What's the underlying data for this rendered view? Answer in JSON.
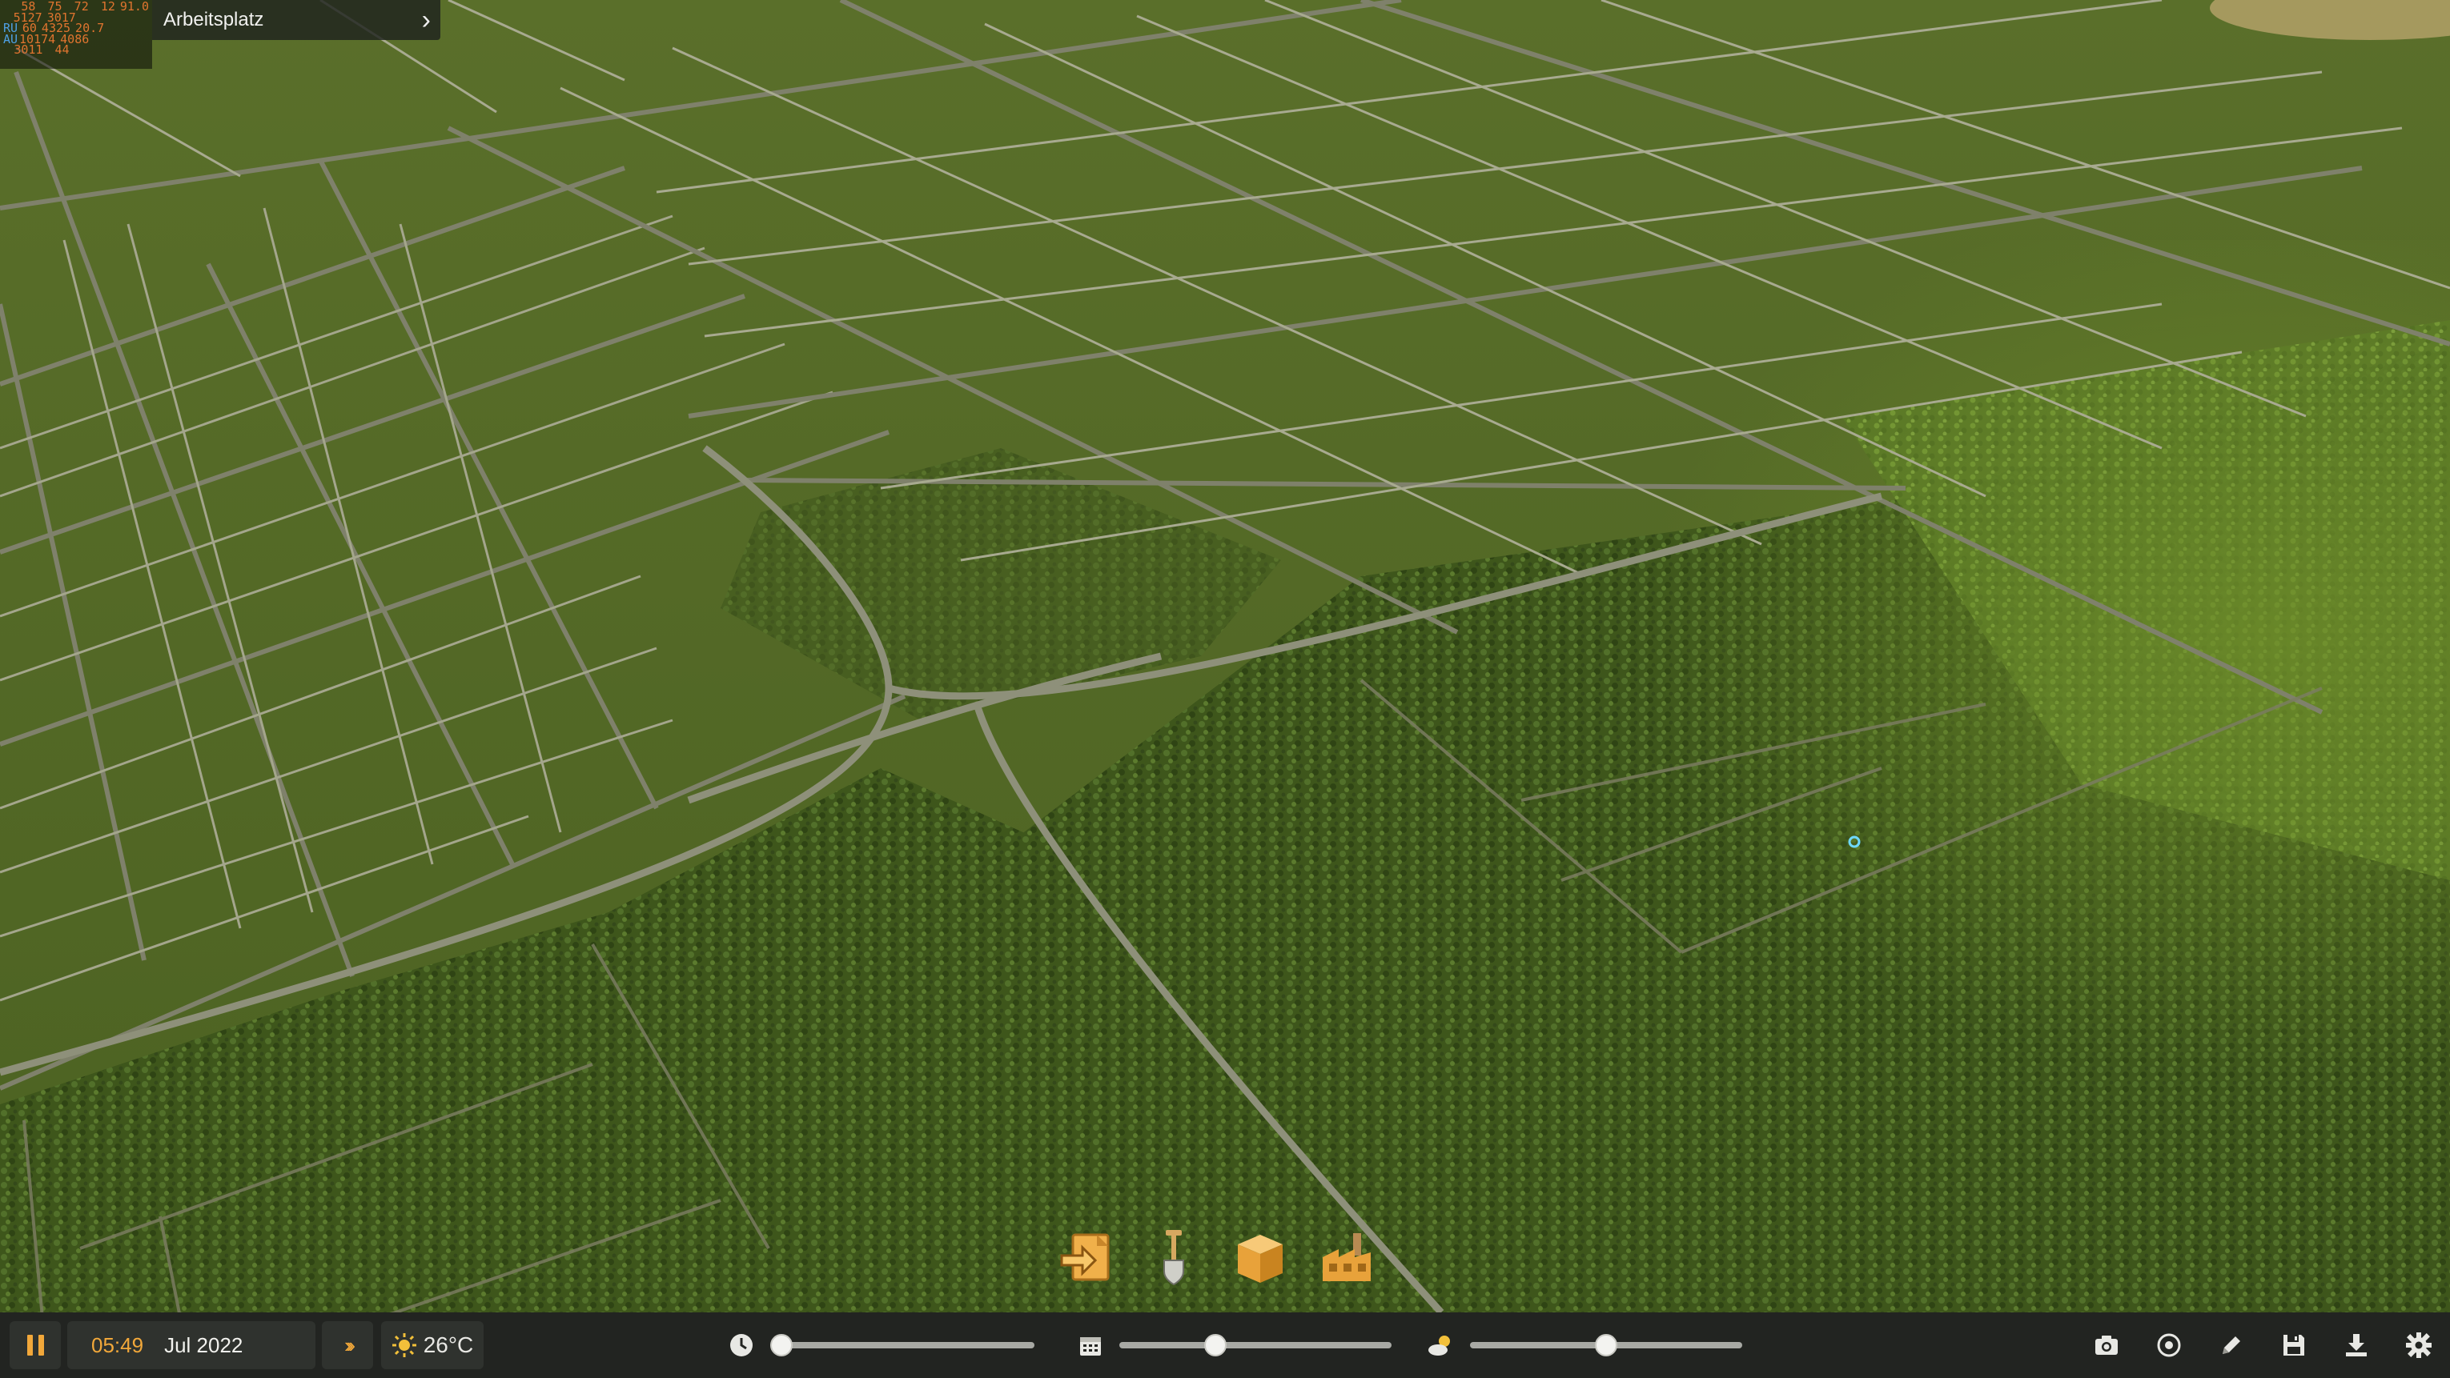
{
  "overlay": {
    "rows": [
      {
        "label": "",
        "c1": "58",
        "c2": "75",
        "c3": "72",
        "c4": "12",
        "c5": "91.0"
      },
      {
        "label": "",
        "c1": "5127",
        "c2": "3017",
        "c3": "",
        "c4": "",
        "c5": ""
      },
      {
        "label": "RU",
        "c1": "60",
        "c2": "4325",
        "c3": "20.7",
        "c4": "",
        "c5": ""
      },
      {
        "label": "AU",
        "c1": "10174",
        "c2": "4086",
        "c3": "",
        "c4": "",
        "c5": ""
      },
      {
        "label": "",
        "c1": "3011",
        "c2": "44",
        "c3": "",
        "c4": "",
        "c5": ""
      }
    ]
  },
  "top_panel": {
    "title": "Arbeitsplatz",
    "chevron": "›"
  },
  "tools": [
    {
      "name": "import-tool",
      "icon": "arrow-into-box-icon",
      "color": "#f0b04a"
    },
    {
      "name": "terraform-tool",
      "icon": "shovel-icon",
      "color": "#d8d8d0"
    },
    {
      "name": "objects-tool",
      "icon": "crate-icon",
      "color": "#f0b04a"
    },
    {
      "name": "buildings-tool",
      "icon": "factory-icon",
      "color": "#f0b04a"
    }
  ],
  "bottom_bar": {
    "time": "05:49",
    "date": "Jul 2022",
    "fast_forward": "›››",
    "temperature": "26°C",
    "sliders": {
      "time_of_day": 0.0,
      "date": 0.34,
      "weather": 0.5
    }
  },
  "colors": {
    "accent": "#f2a83a",
    "bar": "#222421",
    "grass": "#4e6423",
    "forest": "#3a4f1a",
    "road": "#8c8e78"
  }
}
